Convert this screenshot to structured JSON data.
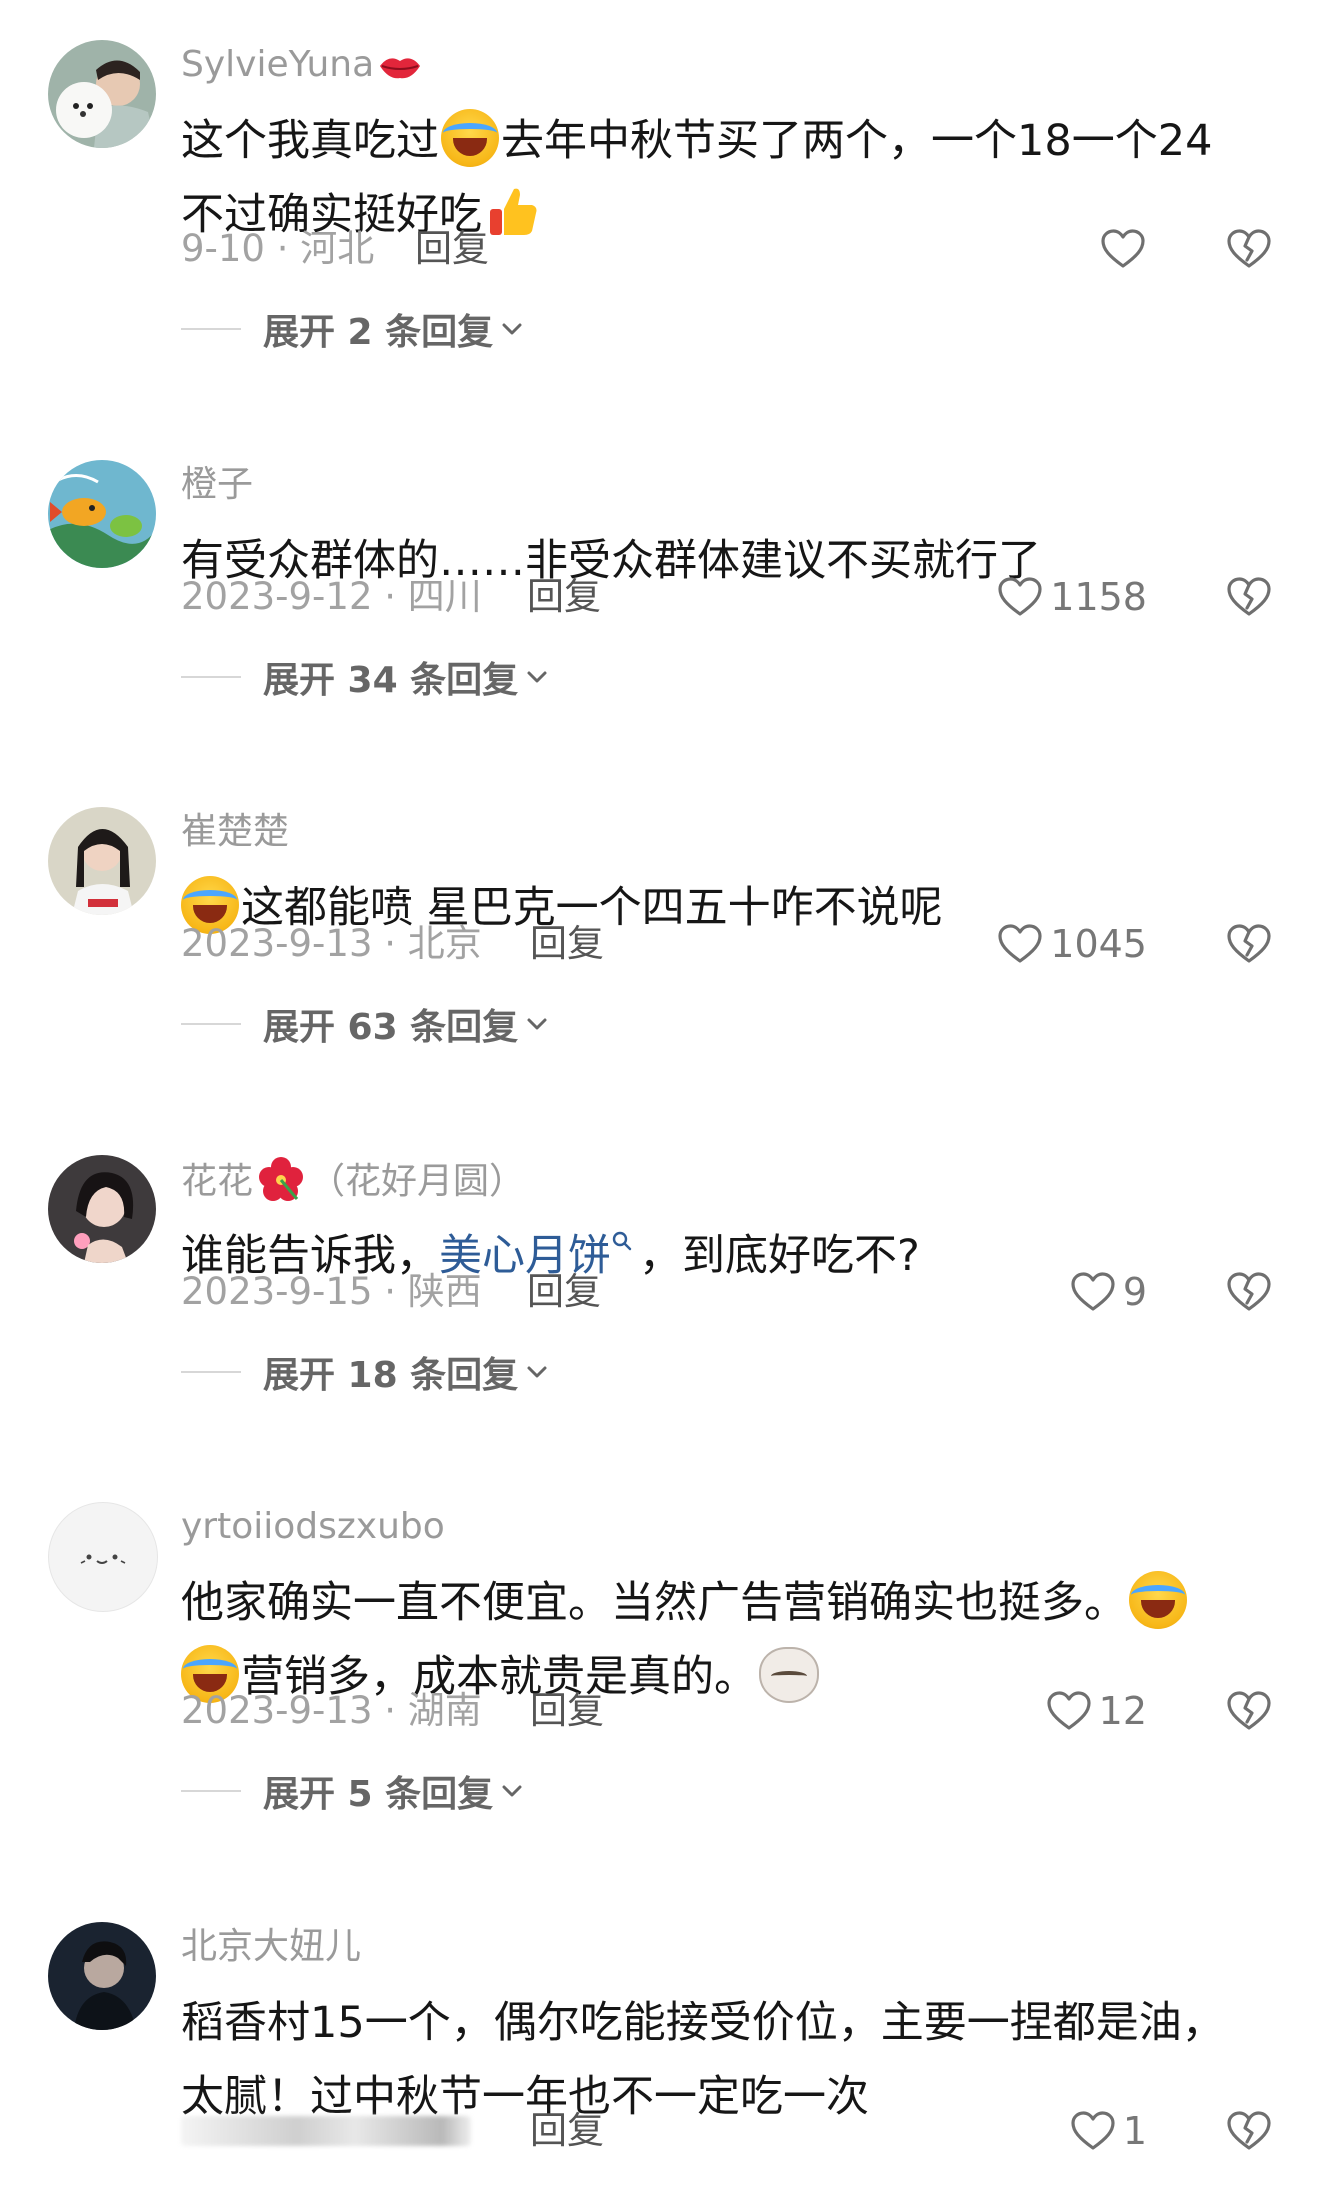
{
  "colors": {
    "text": "#161616",
    "muted": "#a2a2a2",
    "username": "#9a9a9a",
    "link": "#2e5c97"
  },
  "reply_label": "回复",
  "comments": [
    {
      "username": "SylvieYuna",
      "username_emoji": "kiss-lips-icon",
      "lines": [
        "这个我真吃过",
        "去年中秋节买了两个，一个18一个24",
        "不过确实挺好吃"
      ],
      "date_location": "9-10 · 河北",
      "likes": "",
      "expand": "展开 2 条回复"
    },
    {
      "username": "橙子",
      "lines": [
        "有受众群体的……非受众群体建议不买就行了"
      ],
      "date_location": "2023-9-12 · 四川",
      "likes": "1158",
      "expand": "展开 34 条回复"
    },
    {
      "username": "崔楚楚",
      "lines": [
        "这都能喷 星巴克一个四五十咋不说呢"
      ],
      "date_location": "2023-9-13 · 北京",
      "likes": "1045",
      "expand": "展开 63 条回复"
    },
    {
      "username": "花花",
      "username_suffix": "（花好月圆）",
      "username_emoji": "hibiscus-flower-icon",
      "lines": [
        "谁能告诉我，",
        "美心月饼",
        "，到底好吃不?"
      ],
      "date_location": "2023-9-15 · 陕西",
      "likes": "9",
      "expand": "展开 18 条回复"
    },
    {
      "username": "yrtoiiodszxubo",
      "lines": [
        "他家确实一直不便宜。当然广告营销确实也挺多。",
        "营销多，成本就贵是真的。"
      ],
      "date_location": "2023-9-13 · 湖南",
      "likes": "12",
      "expand": "展开 5 条回复"
    },
    {
      "username": "北京大妞儿",
      "lines": [
        "稻香村15一个，偶尔吃能接受价位，主要一捏都是油，",
        "太腻！过中秋节一年也不一定吃一次"
      ],
      "date_location": "",
      "likes": "1",
      "expand": ""
    }
  ]
}
